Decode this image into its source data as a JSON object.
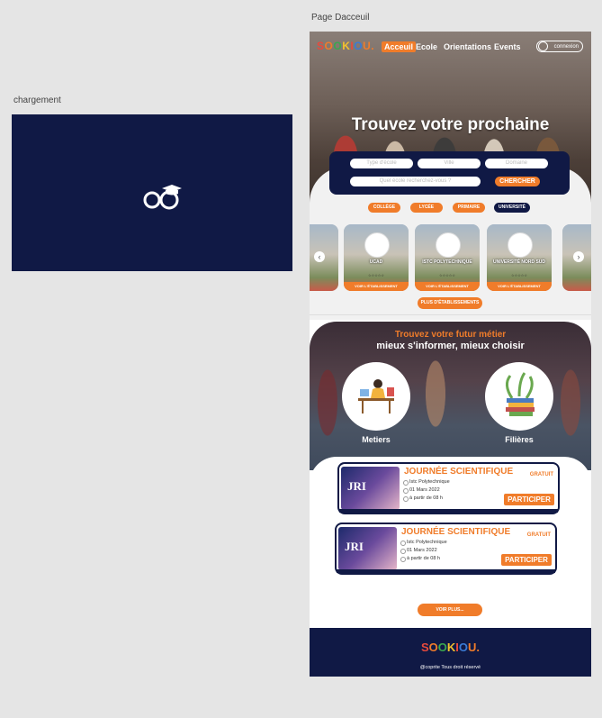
{
  "artboards": {
    "loading_label": "chargement",
    "home_label": "Page Dacceuil"
  },
  "brand": {
    "letters": [
      "S",
      "O",
      "O",
      "K",
      "I",
      "O",
      "U",
      "."
    ],
    "colors": [
      "#e84a3c",
      "#f07c2a",
      "#3aa84f",
      "#f2c12e",
      "#e84a3c",
      "#3a7bd5",
      "#f07c2a",
      "#f07c2a"
    ]
  },
  "nav": {
    "items": [
      "Acceuil",
      "Ecole",
      "Orientations",
      "Events"
    ],
    "active": "Acceuil",
    "login": "connexion"
  },
  "hero": {
    "title": "Trouvez votre prochaine"
  },
  "search": {
    "field1": "Type d'école",
    "field2": "Ville",
    "field3": "Domaine",
    "field4": "Quel école recherchez-vous ?",
    "button": "CHERCHER"
  },
  "categories": [
    {
      "label": "COLLÈGE",
      "color": "#f07c2a"
    },
    {
      "label": "LYCÉE",
      "color": "#f07c2a"
    },
    {
      "label": "PRIMAIRE",
      "color": "#f07c2a"
    },
    {
      "label": "UNIVERSITÉ",
      "color": "#101945"
    }
  ],
  "schools": [
    {
      "name": "UCAD",
      "rating": "☆☆☆☆☆",
      "cta": "VOIR L'ÉTABLISSEMENT"
    },
    {
      "name": "ISTC POLYTECHNIQUE",
      "rating": "☆☆☆☆☆",
      "cta": "VOIR L'ÉTABLISSEMENT"
    },
    {
      "name": "UNIVERSITÉ NORD SUD",
      "rating": "☆☆☆☆☆",
      "cta": "VOIR L'ÉTABLISSEMENT"
    }
  ],
  "more_schools": "PLUS D'ÉTABLISSEMENTS",
  "careers": {
    "title": "Trouvez votre futur métier",
    "subtitle": "mieux s'informer, mieux choisir",
    "left": "Metiers",
    "right": "Filières"
  },
  "events": [
    {
      "title": "JOURNÉE SCIENTIFIQUE",
      "price": "GRATUIT",
      "place": "Istc Polytechnique",
      "date": "01 Mars 2022",
      "time": "à partir de 08 h",
      "button": "PARTICIPER",
      "thumb": "JRI"
    },
    {
      "title": "JOURNÉE SCIENTIFIQUE",
      "price": "GRATUIT",
      "place": "Istc Polytechnique",
      "date": "01 Mars 2022",
      "time": "à partir de 08 h",
      "button": "PARTICIPER",
      "thumb": "JRI"
    }
  ],
  "see_more": "VOIR PLUS...",
  "footer": {
    "copyright": "@coprite Tous droit réservé"
  },
  "colors": {
    "navy": "#101945",
    "orange": "#f07c2a"
  }
}
